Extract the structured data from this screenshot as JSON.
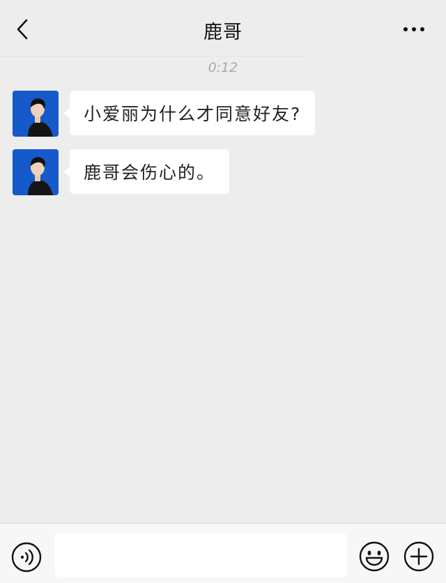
{
  "header": {
    "title": "鹿哥",
    "back_icon": "chevron-left-icon",
    "more_icon": "more-dots-icon"
  },
  "timestamp": "0:12",
  "messages": [
    {
      "sender": "鹿哥",
      "avatar": "avatar-photo",
      "text": "小爱丽为什么才同意好友?"
    },
    {
      "sender": "鹿哥",
      "avatar": "avatar-photo",
      "text": "鹿哥会伤心的。"
    }
  ],
  "input_bar": {
    "voice_icon": "voice-icon",
    "input_value": "",
    "emoji_icon": "emoji-icon",
    "plus_icon": "plus-icon"
  },
  "colors": {
    "background": "#ededed",
    "bubble": "#ffffff",
    "avatar_bg": "#1a5fd0",
    "timestamp": "#a8a8a8"
  }
}
